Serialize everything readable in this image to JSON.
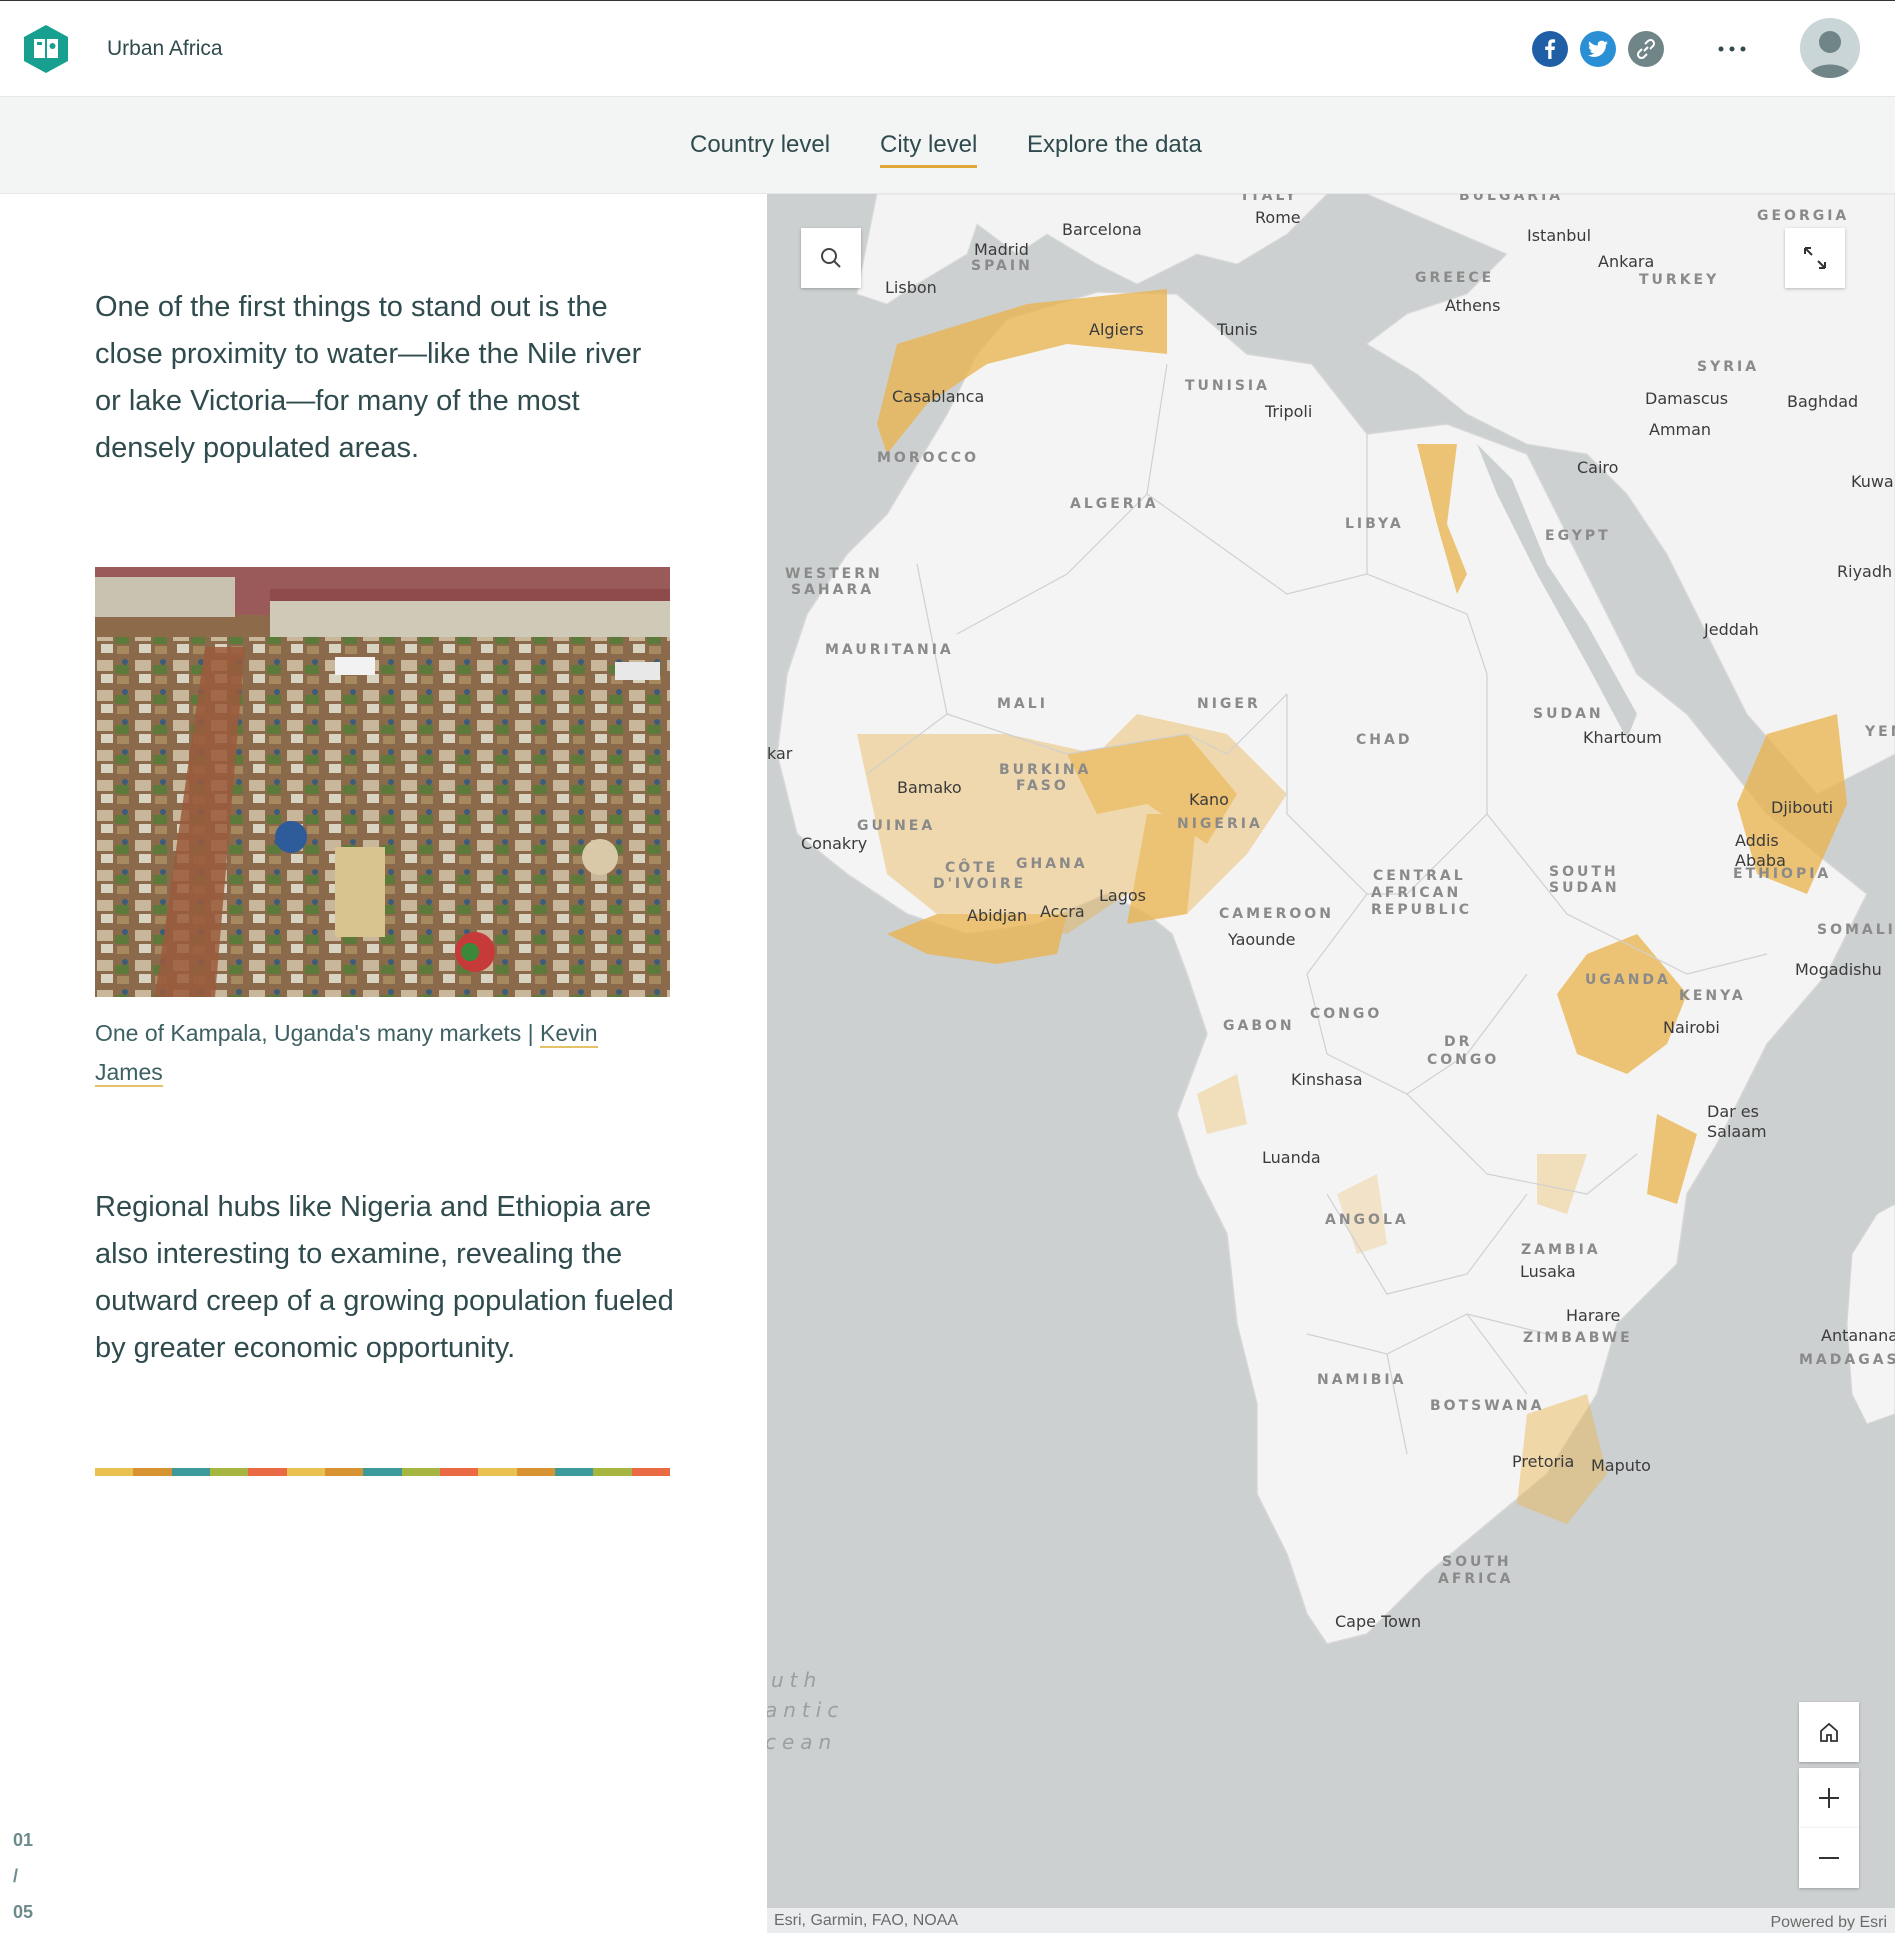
{
  "header": {
    "title": "Urban Africa",
    "share": {
      "facebook_icon": "facebook-icon",
      "twitter_icon": "twitter-icon",
      "link_icon": "link-icon"
    },
    "more_label": "···"
  },
  "nav": {
    "tabs": [
      {
        "label": "Country level",
        "active": false
      },
      {
        "label": "City level",
        "active": true
      },
      {
        "label": "Explore the data",
        "active": false
      }
    ]
  },
  "narrative": {
    "paragraph_1": "One of the first things to stand out is the close proximity to water—like the Nile river or lake Victoria—for many of the most densely populated areas.",
    "image_caption_prefix": "One of Kampala, Uganda's many markets | ",
    "image_caption_link": "Kevin James",
    "paragraph_2": "Regional hubs like Nigeria and Ethiopia are also interesting to examine, revealing the outward creep of a growing population fueled by greater economic opportunity.",
    "strip_colors": [
      "#e8c14f",
      "#d89433",
      "#3d9a9a",
      "#a6b640",
      "#ea6a45",
      "#e8c14f",
      "#d89433",
      "#3d9a9a",
      "#a6b640",
      "#ea6a45",
      "#e8c14f",
      "#d89433",
      "#3d9a9a",
      "#a6b640",
      "#ea6a45"
    ],
    "pager": {
      "current": "01",
      "separator": "/",
      "total": "05"
    }
  },
  "map": {
    "cities": [
      {
        "name": "Madrid"
      },
      {
        "name": "Barcelona"
      },
      {
        "name": "Rome"
      },
      {
        "name": "Lisbon"
      },
      {
        "name": "Istanbul"
      },
      {
        "name": "Ankara"
      },
      {
        "name": "Athens"
      },
      {
        "name": "Algiers"
      },
      {
        "name": "Tunis"
      },
      {
        "name": "Casablanca"
      },
      {
        "name": "Tripoli"
      },
      {
        "name": "Damascus"
      },
      {
        "name": "Amman"
      },
      {
        "name": "Baghdad"
      },
      {
        "name": "Cairo"
      },
      {
        "name": "Kuwait"
      },
      {
        "name": "Riyadh"
      },
      {
        "name": "Jeddah"
      },
      {
        "name": "Khartoum"
      },
      {
        "name": "Djibouti"
      },
      {
        "name": "Addis"
      },
      {
        "name": "Ababa"
      },
      {
        "name": "Bamako"
      },
      {
        "name": "Kano"
      },
      {
        "name": "Conakry"
      },
      {
        "name": "Abidjan"
      },
      {
        "name": "Accra"
      },
      {
        "name": "Lagos"
      },
      {
        "name": "Yaounde"
      },
      {
        "name": "Mogadishu"
      },
      {
        "name": "Nairobi"
      },
      {
        "name": "Kinshasa"
      },
      {
        "name": "Dar es"
      },
      {
        "name": "Salaam"
      },
      {
        "name": "Luanda"
      },
      {
        "name": "Lusaka"
      },
      {
        "name": "Harare"
      },
      {
        "name": "Antanana"
      },
      {
        "name": "Pretoria"
      },
      {
        "name": "Maputo"
      },
      {
        "name": "Cape Town"
      },
      {
        "name": "kar"
      }
    ],
    "countries": [
      {
        "name": "SPAIN"
      },
      {
        "name": "ITALY"
      },
      {
        "name": "BULGARIA"
      },
      {
        "name": "GEORGIA"
      },
      {
        "name": "GREECE"
      },
      {
        "name": "TURKEY"
      },
      {
        "name": "TUNISIA"
      },
      {
        "name": "SYRIA"
      },
      {
        "name": "MOROCCO"
      },
      {
        "name": "ALGERIA"
      },
      {
        "name": "LIBYA"
      },
      {
        "name": "EGYPT"
      },
      {
        "name": "WESTERN"
      },
      {
        "name": "SAHARA"
      },
      {
        "name": "MAURITANIA"
      },
      {
        "name": "MALI"
      },
      {
        "name": "NIGER"
      },
      {
        "name": "CHAD"
      },
      {
        "name": "SUDAN"
      },
      {
        "name": "YEME"
      },
      {
        "name": "BURKINA"
      },
      {
        "name": "FASO"
      },
      {
        "name": "NIGERIA"
      },
      {
        "name": "GUINEA"
      },
      {
        "name": "CÔTE"
      },
      {
        "name": "D'IVOIRE"
      },
      {
        "name": "GHANA"
      },
      {
        "name": "CAMEROON"
      },
      {
        "name": "CENTRAL"
      },
      {
        "name": "AFRICAN"
      },
      {
        "name": "REPUBLIC"
      },
      {
        "name": "SOUTH"
      },
      {
        "name": "SUDAN"
      },
      {
        "name": "ETHIOPIA"
      },
      {
        "name": "SOMALIA"
      },
      {
        "name": "UGANDA"
      },
      {
        "name": "KENYA"
      },
      {
        "name": "GABON"
      },
      {
        "name": "CONGO"
      },
      {
        "name": "DR"
      },
      {
        "name": "CONGO"
      },
      {
        "name": "ANGOLA"
      },
      {
        "name": "ZAMBIA"
      },
      {
        "name": "ZIMBABWE"
      },
      {
        "name": "MADAGASC"
      },
      {
        "name": "NAMIBIA"
      },
      {
        "name": "BOTSWANA"
      },
      {
        "name": "SOUTH"
      },
      {
        "name": "AFRICA"
      }
    ],
    "ocean": [
      {
        "name": "uth"
      },
      {
        "name": "antic"
      },
      {
        "name": "cean"
      }
    ],
    "attribution_left": "Esri, Garmin, FAO, NOAA",
    "attribution_right": "Powered by Esri",
    "colors": {
      "water": "#cdd0d1",
      "land": "#f3f3f3",
      "density": "#eab34a"
    }
  }
}
